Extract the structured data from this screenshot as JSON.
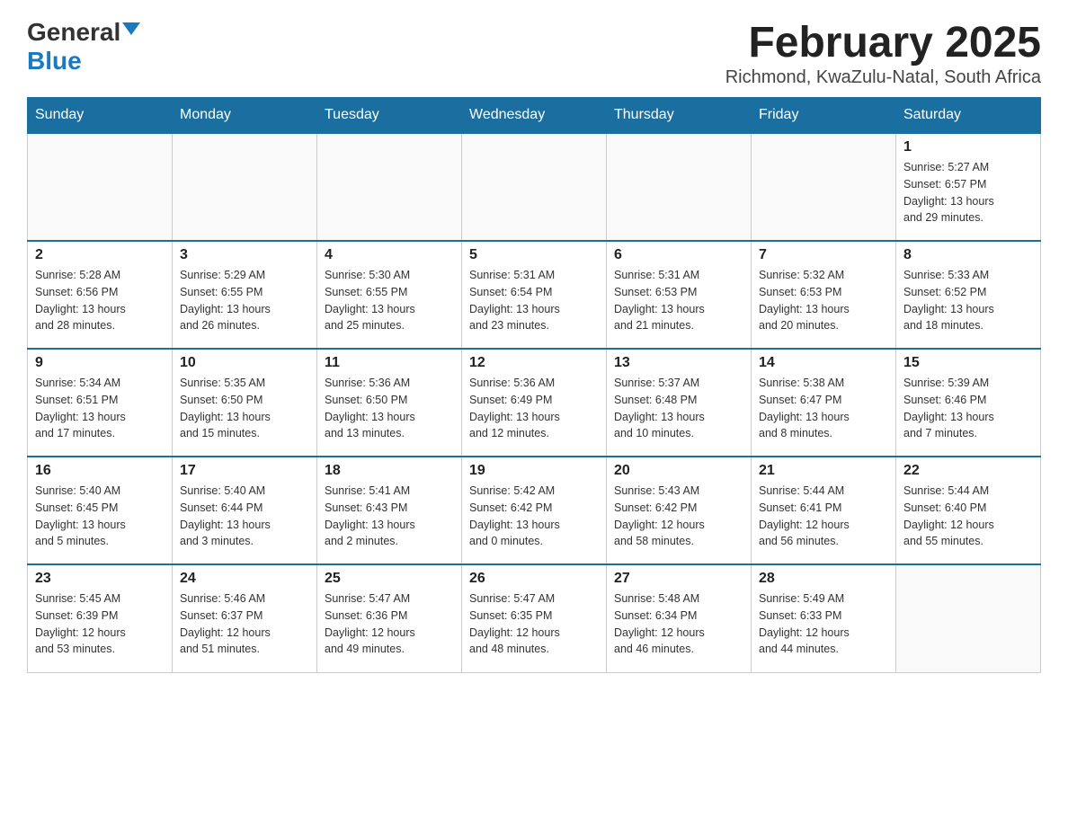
{
  "header": {
    "logo_general": "General",
    "logo_blue": "Blue",
    "title": "February 2025",
    "subtitle": "Richmond, KwaZulu-Natal, South Africa"
  },
  "weekdays": [
    "Sunday",
    "Monday",
    "Tuesday",
    "Wednesday",
    "Thursday",
    "Friday",
    "Saturday"
  ],
  "weeks": [
    [
      {
        "day": "",
        "info": ""
      },
      {
        "day": "",
        "info": ""
      },
      {
        "day": "",
        "info": ""
      },
      {
        "day": "",
        "info": ""
      },
      {
        "day": "",
        "info": ""
      },
      {
        "day": "",
        "info": ""
      },
      {
        "day": "1",
        "info": "Sunrise: 5:27 AM\nSunset: 6:57 PM\nDaylight: 13 hours\nand 29 minutes."
      }
    ],
    [
      {
        "day": "2",
        "info": "Sunrise: 5:28 AM\nSunset: 6:56 PM\nDaylight: 13 hours\nand 28 minutes."
      },
      {
        "day": "3",
        "info": "Sunrise: 5:29 AM\nSunset: 6:55 PM\nDaylight: 13 hours\nand 26 minutes."
      },
      {
        "day": "4",
        "info": "Sunrise: 5:30 AM\nSunset: 6:55 PM\nDaylight: 13 hours\nand 25 minutes."
      },
      {
        "day": "5",
        "info": "Sunrise: 5:31 AM\nSunset: 6:54 PM\nDaylight: 13 hours\nand 23 minutes."
      },
      {
        "day": "6",
        "info": "Sunrise: 5:31 AM\nSunset: 6:53 PM\nDaylight: 13 hours\nand 21 minutes."
      },
      {
        "day": "7",
        "info": "Sunrise: 5:32 AM\nSunset: 6:53 PM\nDaylight: 13 hours\nand 20 minutes."
      },
      {
        "day": "8",
        "info": "Sunrise: 5:33 AM\nSunset: 6:52 PM\nDaylight: 13 hours\nand 18 minutes."
      }
    ],
    [
      {
        "day": "9",
        "info": "Sunrise: 5:34 AM\nSunset: 6:51 PM\nDaylight: 13 hours\nand 17 minutes."
      },
      {
        "day": "10",
        "info": "Sunrise: 5:35 AM\nSunset: 6:50 PM\nDaylight: 13 hours\nand 15 minutes."
      },
      {
        "day": "11",
        "info": "Sunrise: 5:36 AM\nSunset: 6:50 PM\nDaylight: 13 hours\nand 13 minutes."
      },
      {
        "day": "12",
        "info": "Sunrise: 5:36 AM\nSunset: 6:49 PM\nDaylight: 13 hours\nand 12 minutes."
      },
      {
        "day": "13",
        "info": "Sunrise: 5:37 AM\nSunset: 6:48 PM\nDaylight: 13 hours\nand 10 minutes."
      },
      {
        "day": "14",
        "info": "Sunrise: 5:38 AM\nSunset: 6:47 PM\nDaylight: 13 hours\nand 8 minutes."
      },
      {
        "day": "15",
        "info": "Sunrise: 5:39 AM\nSunset: 6:46 PM\nDaylight: 13 hours\nand 7 minutes."
      }
    ],
    [
      {
        "day": "16",
        "info": "Sunrise: 5:40 AM\nSunset: 6:45 PM\nDaylight: 13 hours\nand 5 minutes."
      },
      {
        "day": "17",
        "info": "Sunrise: 5:40 AM\nSunset: 6:44 PM\nDaylight: 13 hours\nand 3 minutes."
      },
      {
        "day": "18",
        "info": "Sunrise: 5:41 AM\nSunset: 6:43 PM\nDaylight: 13 hours\nand 2 minutes."
      },
      {
        "day": "19",
        "info": "Sunrise: 5:42 AM\nSunset: 6:42 PM\nDaylight: 13 hours\nand 0 minutes."
      },
      {
        "day": "20",
        "info": "Sunrise: 5:43 AM\nSunset: 6:42 PM\nDaylight: 12 hours\nand 58 minutes."
      },
      {
        "day": "21",
        "info": "Sunrise: 5:44 AM\nSunset: 6:41 PM\nDaylight: 12 hours\nand 56 minutes."
      },
      {
        "day": "22",
        "info": "Sunrise: 5:44 AM\nSunset: 6:40 PM\nDaylight: 12 hours\nand 55 minutes."
      }
    ],
    [
      {
        "day": "23",
        "info": "Sunrise: 5:45 AM\nSunset: 6:39 PM\nDaylight: 12 hours\nand 53 minutes."
      },
      {
        "day": "24",
        "info": "Sunrise: 5:46 AM\nSunset: 6:37 PM\nDaylight: 12 hours\nand 51 minutes."
      },
      {
        "day": "25",
        "info": "Sunrise: 5:47 AM\nSunset: 6:36 PM\nDaylight: 12 hours\nand 49 minutes."
      },
      {
        "day": "26",
        "info": "Sunrise: 5:47 AM\nSunset: 6:35 PM\nDaylight: 12 hours\nand 48 minutes."
      },
      {
        "day": "27",
        "info": "Sunrise: 5:48 AM\nSunset: 6:34 PM\nDaylight: 12 hours\nand 46 minutes."
      },
      {
        "day": "28",
        "info": "Sunrise: 5:49 AM\nSunset: 6:33 PM\nDaylight: 12 hours\nand 44 minutes."
      },
      {
        "day": "",
        "info": ""
      }
    ]
  ]
}
